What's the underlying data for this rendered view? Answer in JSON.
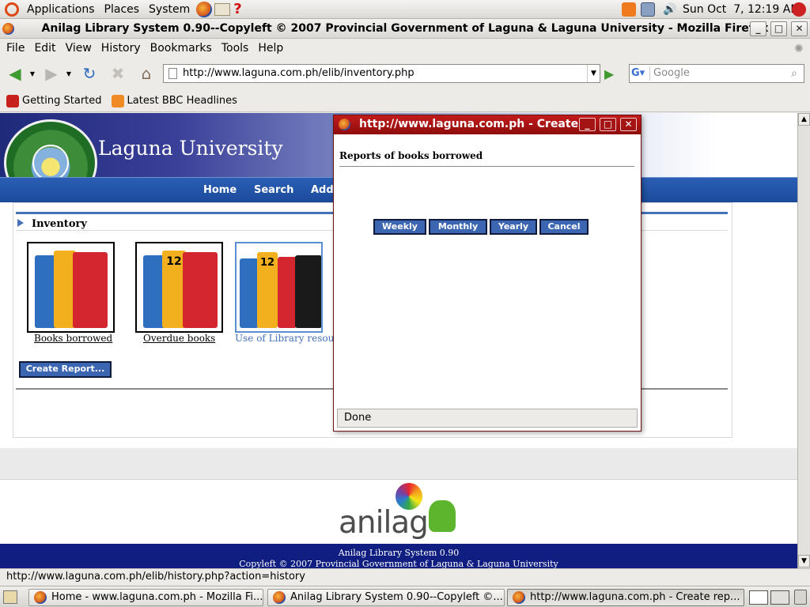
{
  "top_panel": {
    "menus": [
      "Applications",
      "Places",
      "System"
    ],
    "clock": "Sun Oct  7, 12:19 AM"
  },
  "window": {
    "title": "Anilag Library System 0.90--Copyleft © 2007 Provincial Government of Laguna & Laguna University - Mozilla Firefox"
  },
  "menubar": [
    "File",
    "Edit",
    "View",
    "History",
    "Bookmarks",
    "Tools",
    "Help"
  ],
  "navbar": {
    "url": "http://www.laguna.com.ph/elib/inventory.php",
    "search_placeholder": "Google"
  },
  "bookmarks": [
    "Getting Started",
    "Latest BBC Headlines"
  ],
  "page": {
    "university": "Laguna University",
    "nav_links": [
      "Home",
      "Search",
      "Add"
    ],
    "section_title": "Inventory",
    "categories": [
      {
        "label": "Books borrowed"
      },
      {
        "label": "Overdue books"
      },
      {
        "label": "Use of Library resour"
      }
    ],
    "create_report_label": "Create Report...",
    "brand": "anilag",
    "footer_line1": "Anilag Library System 0.90",
    "footer_line2": "Copyleft © 2007 Provincial Government of Laguna & Laguna University"
  },
  "popup": {
    "title": "http://www.laguna.com.ph - Create r",
    "heading": "Reports of books borrowed",
    "buttons": [
      "Weekly",
      "Monthly",
      "Yearly",
      "Cancel"
    ],
    "status": "Done"
  },
  "statusbar": "http://www.laguna.com.ph/elib/history.php?action=history",
  "taskbar": [
    "Home - www.laguna.com.ph - Mozilla Fi...",
    "Anilag Library System 0.90--Copyleft ©...",
    "http://www.laguna.com.ph - Create rep..."
  ],
  "colors": {
    "accent_blue": "#3c66b2",
    "banner_blue": "#1f2a7a",
    "popup_title": "#c21b1b",
    "footer_blue": "#0f1e80"
  }
}
